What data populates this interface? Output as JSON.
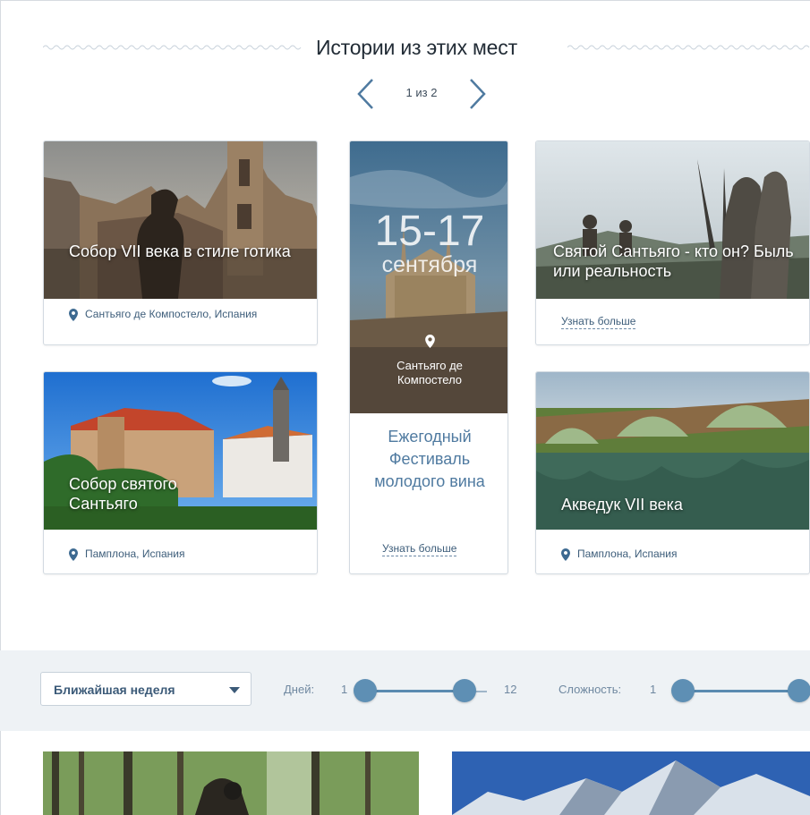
{
  "section": {
    "title": "Истории из этих мест",
    "pager": "1 из 2"
  },
  "cards": [
    {
      "caption": "Собор VII века в стиле готика",
      "location": "Сантьяго де Компостело, Испания"
    },
    {
      "date_big": "15-17",
      "date_month": "сентября",
      "place": "Сантьяго де Компостело",
      "title": "Ежегодный Фестиваль молодого вина",
      "more": "Узнать больше"
    },
    {
      "caption": "Святой Сантьяго - кто он? Быль или реальность",
      "more": "Узнать больше"
    },
    {
      "caption": "Собор святого Сантьяго",
      "location": "Памплона, Испания"
    },
    {
      "caption": "Акведук VII века",
      "location": "Памплона, Испания"
    }
  ],
  "filters": {
    "period": "Ближайшая неделя",
    "days_label": "Дней:",
    "days_min": "1",
    "days_max": "12",
    "difficulty_label": "Сложность:",
    "difficulty_min": "1",
    "days_range": [
      1,
      12
    ],
    "difficulty_range": [
      1,
      5
    ]
  },
  "colors": {
    "accent": "#5e8fb4",
    "link": "#3d5d7a",
    "filter_bg": "#eef2f5"
  }
}
